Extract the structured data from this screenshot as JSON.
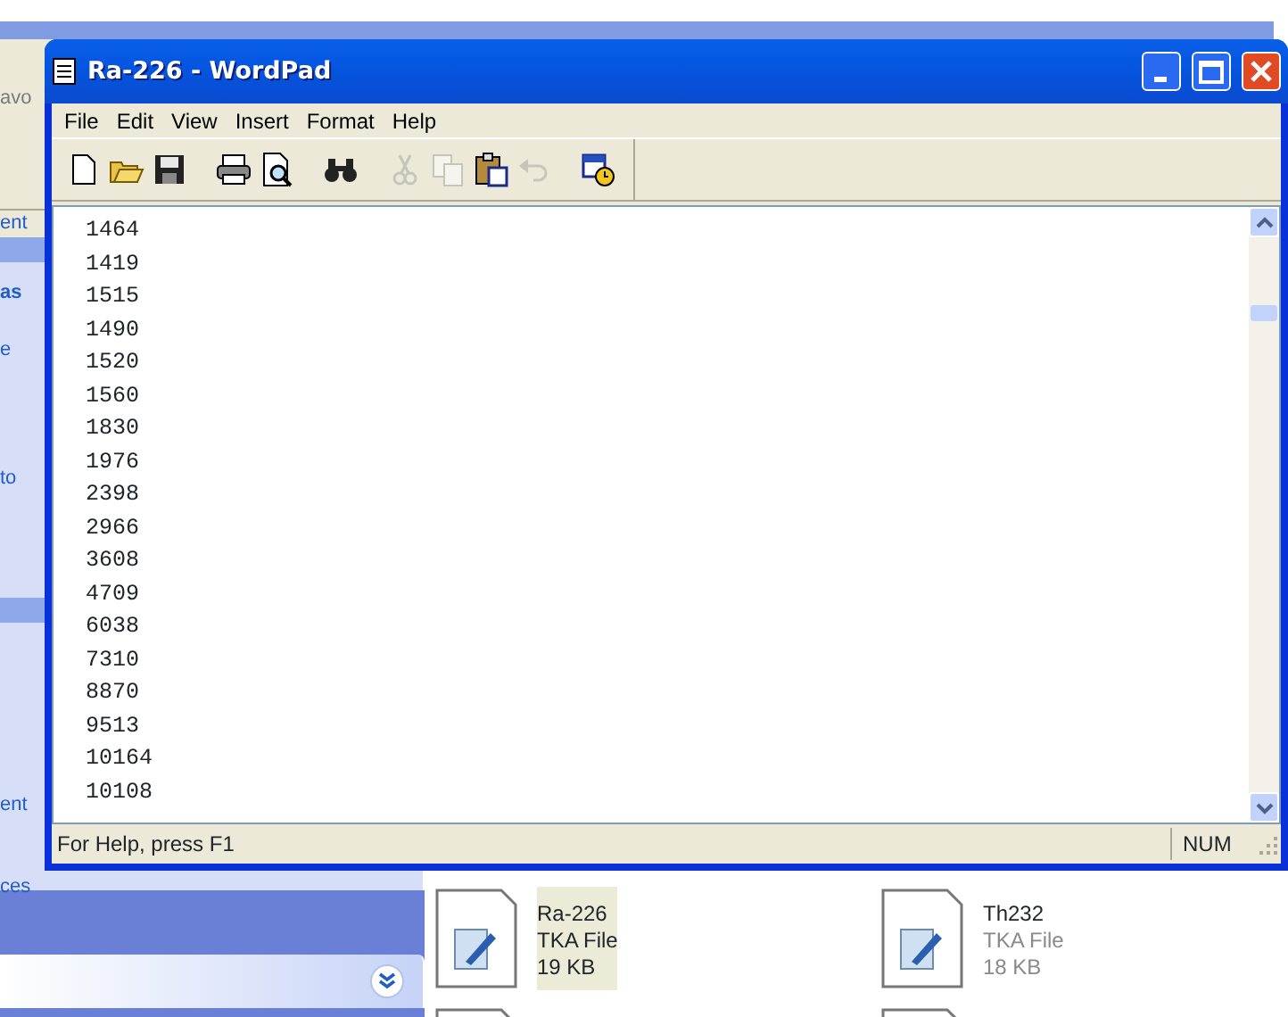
{
  "background_window": {
    "fragments": [
      {
        "text": "avo",
        "kind": "address"
      },
      {
        "text": "ent",
        "kind": "plain"
      },
      {
        "text": "as",
        "kind": "heading"
      },
      {
        "text": "e",
        "kind": "link"
      },
      {
        "text": "to",
        "kind": "link"
      },
      {
        "text": "ent",
        "kind": "link"
      },
      {
        "text": "ces",
        "kind": "link"
      }
    ],
    "files": [
      {
        "name": "Ra-226",
        "type": "TKA File",
        "size": "19 KB",
        "selected": true
      },
      {
        "name": "Th232",
        "type": "TKA File",
        "size": "18 KB",
        "selected": false
      }
    ]
  },
  "window": {
    "title": "Ra-226 - WordPad"
  },
  "menu": [
    "File",
    "Edit",
    "View",
    "Insert",
    "Format",
    "Help"
  ],
  "toolbar": [
    {
      "kind": "new",
      "disabled": false
    },
    {
      "kind": "open",
      "disabled": false
    },
    {
      "kind": "save",
      "disabled": false
    },
    {
      "kind": "sep"
    },
    {
      "kind": "print",
      "disabled": false
    },
    {
      "kind": "preview",
      "disabled": false
    },
    {
      "kind": "sep"
    },
    {
      "kind": "find",
      "disabled": false
    },
    {
      "kind": "sep"
    },
    {
      "kind": "cut",
      "disabled": true
    },
    {
      "kind": "copy",
      "disabled": true
    },
    {
      "kind": "paste",
      "disabled": false
    },
    {
      "kind": "undo",
      "disabled": true
    },
    {
      "kind": "sep"
    },
    {
      "kind": "datetime",
      "disabled": false
    }
  ],
  "document": {
    "lines": [
      "1464",
      "1419",
      "1515",
      "1490",
      "1520",
      "1560",
      "1830",
      "1976",
      "2398",
      "2966",
      "3608",
      "4709",
      "6038",
      "7310",
      "8870",
      "9513",
      "10164",
      "10108"
    ]
  },
  "status_bar": {
    "help": "For Help, press F1",
    "indicator": "NUM"
  }
}
